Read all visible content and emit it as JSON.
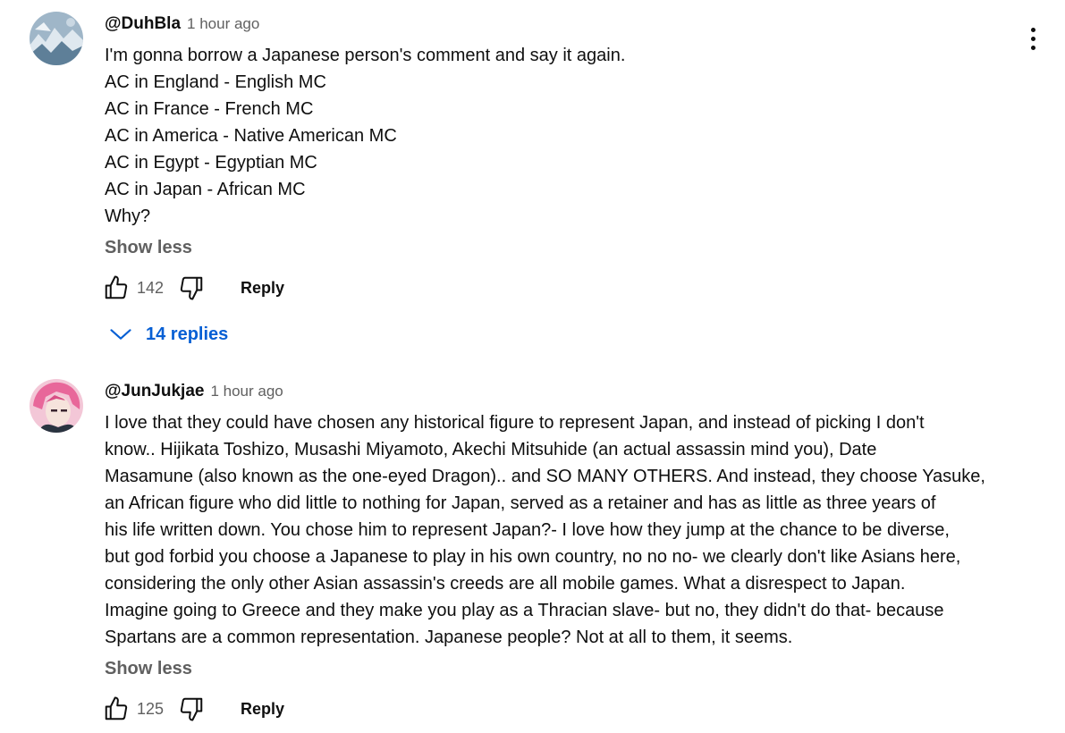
{
  "comments": [
    {
      "author": "@DuhBla",
      "time": "1 hour ago",
      "lines": [
        "I'm gonna borrow a Japanese person's comment and say it again.",
        "AC in England - English MC",
        "AC in France - French MC",
        "AC in America - Native American MC",
        "AC in Egypt - Egyptian MC",
        "AC in Japan - African MC",
        "Why?"
      ],
      "show_less": "Show less",
      "likes": "142",
      "reply": "Reply",
      "replies_label": "14 replies",
      "like_icon": "thumbs-up-icon",
      "dislike_icon": "thumbs-down-icon"
    },
    {
      "author": "@JunJukjae",
      "time": "1 hour ago",
      "lines": [
        "I love that they could have chosen any historical figure to represent Japan, and instead of picking I don't",
        "know.. Hijikata Toshizo, Musashi Miyamoto, Akechi Mitsuhide (an actual assassin mind you), Date",
        "Masamune (also known as the one-eyed Dragon).. and SO MANY OTHERS. And instead, they choose Yasuke,",
        "an African figure who did little to nothing for Japan, served as a retainer and has as little as three years of",
        "his life written down. You chose him to represent Japan?- I love how they jump at the chance to be diverse,",
        "but god forbid you choose a Japanese to play in his own country, no no no- we clearly don't like Asians here,",
        "considering the only other Asian assassin's creeds are all mobile games. What a disrespect to Japan.",
        "Imagine going to Greece and they make you play as a Thracian slave- but no, they didn't do that- because",
        "Spartans are a common representation. Japanese people? Not at all to them, it seems."
      ],
      "show_less": "Show less",
      "likes": "125",
      "reply": "Reply",
      "like_icon": "thumbs-up-icon",
      "dislike_icon": "thumbs-down-icon"
    }
  ],
  "menu_icon": "more-vert-icon",
  "colors": {
    "link": "#065fd4",
    "secondary": "#606060",
    "primary": "#0f0f0f"
  }
}
